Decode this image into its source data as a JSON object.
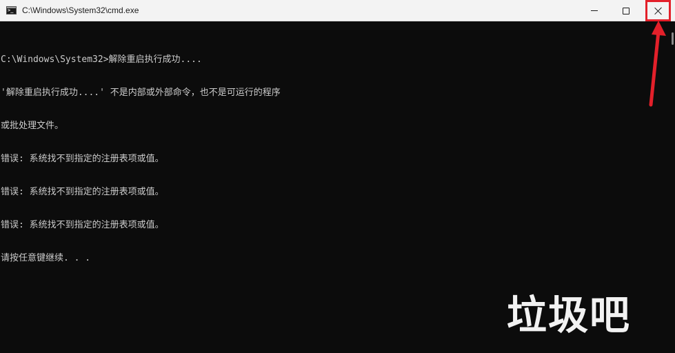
{
  "window": {
    "title": "C:\\Windows\\System32\\cmd.exe",
    "app_icon": "cmd-icon"
  },
  "caption_buttons": {
    "minimize_icon": "minimize-icon",
    "maximize_icon": "maximize-icon",
    "close_icon": "close-icon"
  },
  "console": {
    "lines": [
      "C:\\Windows\\System32>解除重启执行成功....",
      "'解除重启执行成功....' 不是内部或外部命令，也不是可运行的程序",
      "或批处理文件。",
      "错误: 系统找不到指定的注册表项或值。",
      "错误: 系统找不到指定的注册表项或值。",
      "错误: 系统找不到指定的注册表项或值。",
      "请按任意键继续. . ."
    ]
  },
  "overlay": {
    "caption": "垃圾吧"
  },
  "colors": {
    "titlebar_bg": "#f3f3f3",
    "console_bg": "#0c0c0c",
    "console_text": "#cccccc",
    "annotation_red": "#e3202a"
  }
}
